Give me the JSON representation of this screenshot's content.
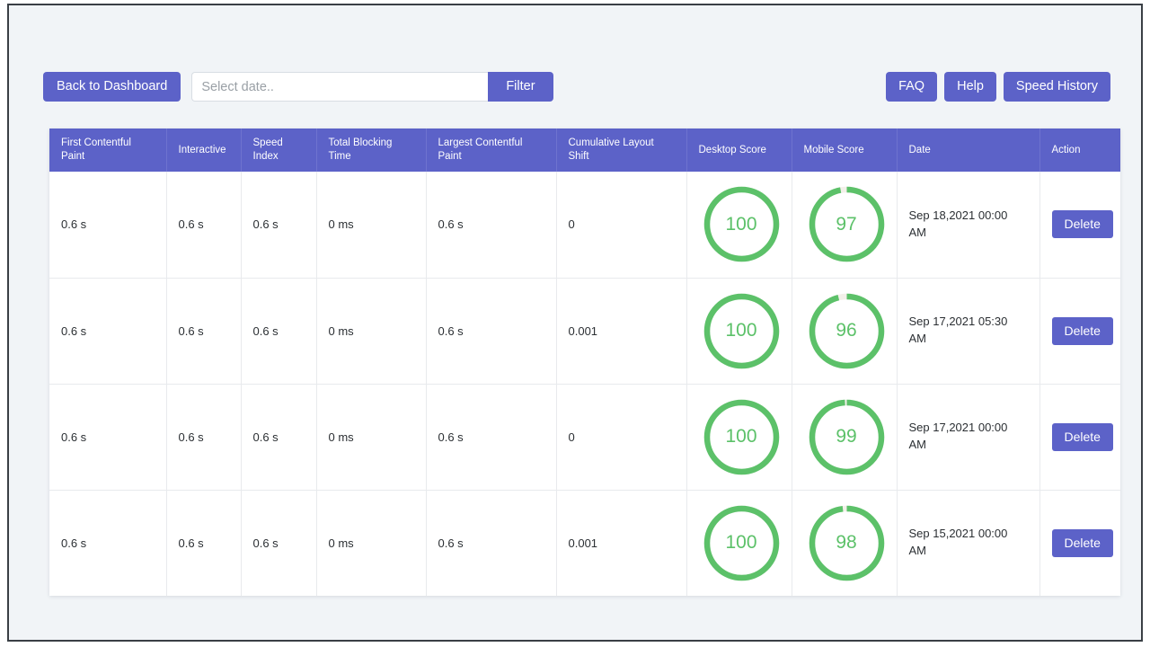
{
  "theme": {
    "accent": "#5c62c8",
    "accent_hover": "#5056bd",
    "gauge_green": "#5cc169",
    "gauge_track": "#f3f0ea",
    "page_bg": "#f1f4f7",
    "card_bg": "#ffffff",
    "border": "#e8eaed",
    "text": "#2b2f33",
    "placeholder": "#9aa0a6"
  },
  "toolbar": {
    "back_label": "Back to Dashboard",
    "date_placeholder": "Select date..",
    "date_value": "",
    "filter_label": "Filter",
    "faq_label": "FAQ",
    "help_label": "Help",
    "speed_history_label": "Speed History"
  },
  "table": {
    "columns": [
      "First Contentful Paint",
      "Interactive",
      "Speed Index",
      "Total Blocking Time",
      "Largest Contentful Paint",
      "Cumulative Layout Shift",
      "Desktop Score",
      "Mobile Score",
      "Date",
      "Action"
    ],
    "action_label": "Delete",
    "rows": [
      {
        "first_contentful_paint": "0.6 s",
        "interactive": "0.6 s",
        "speed_index": "0.6 s",
        "total_blocking_time": "0 ms",
        "largest_contentful_paint": "0.6 s",
        "cumulative_layout_shift": "0",
        "desktop_score": "100",
        "mobile_score": "97",
        "date": "Sep 18,2021 00:00 AM",
        "action": "Delete"
      },
      {
        "first_contentful_paint": "0.6 s",
        "interactive": "0.6 s",
        "speed_index": "0.6 s",
        "total_blocking_time": "0 ms",
        "largest_contentful_paint": "0.6 s",
        "cumulative_layout_shift": "0.001",
        "desktop_score": "100",
        "mobile_score": "96",
        "date": "Sep 17,2021 05:30 AM",
        "action": "Delete"
      },
      {
        "first_contentful_paint": "0.6 s",
        "interactive": "0.6 s",
        "speed_index": "0.6 s",
        "total_blocking_time": "0 ms",
        "largest_contentful_paint": "0.6 s",
        "cumulative_layout_shift": "0",
        "desktop_score": "100",
        "mobile_score": "99",
        "date": "Sep 17,2021 00:00 AM",
        "action": "Delete"
      },
      {
        "first_contentful_paint": "0.6 s",
        "interactive": "0.6 s",
        "speed_index": "0.6 s",
        "total_blocking_time": "0 ms",
        "largest_contentful_paint": "0.6 s",
        "cumulative_layout_shift": "0.001",
        "desktop_score": "100",
        "mobile_score": "98",
        "date": "Sep 15,2021 00:00 AM",
        "action": "Delete"
      }
    ]
  },
  "chart_data": {
    "type": "gauge",
    "title": "Lighthouse performance scores per run",
    "max": 100,
    "unit": "score",
    "series": [
      {
        "name": "Desktop Score",
        "values": [
          100,
          100,
          100,
          100
        ]
      },
      {
        "name": "Mobile Score",
        "values": [
          97,
          96,
          99,
          98
        ]
      }
    ],
    "categories": [
      "Sep 18,2021 00:00 AM",
      "Sep 17,2021 05:30 AM",
      "Sep 17,2021 00:00 AM",
      "Sep 15,2021 00:00 AM"
    ],
    "colors": {
      "arc": "#5cc169",
      "track": "#f3f0ea"
    }
  }
}
